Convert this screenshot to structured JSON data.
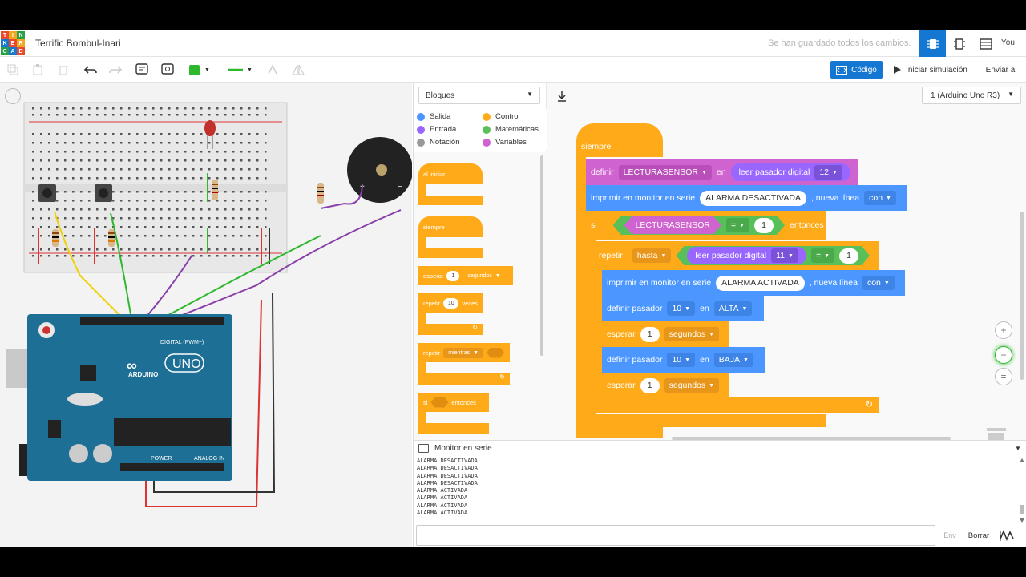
{
  "logo_letters": [
    "T",
    "I",
    "N",
    "K",
    "E",
    "R",
    "C",
    "A",
    "D"
  ],
  "logo_colors": [
    "#e84a2b",
    "#f0a820",
    "#2a9f4a",
    "#1477d1",
    "#e84a2b",
    "#f0a820",
    "#2a9f4a",
    "#1477d1",
    "#e84a2b"
  ],
  "header": {
    "title": "Terrific Bombul-Inari",
    "saved_status": "Se han guardado todos los cambios.",
    "user": "You"
  },
  "toolbar": {
    "code_label": "Código",
    "simulate_label": "Iniciar simulación",
    "send_label": "Enviar a",
    "fill_color": "#2eb82e"
  },
  "palette": {
    "selector": "Bloques",
    "categories": [
      {
        "label": "Salida",
        "color": "#4c97ff"
      },
      {
        "label": "Control",
        "color": "#ffab19"
      },
      {
        "label": "Entrada",
        "color": "#9966ff"
      },
      {
        "label": "Matemáticas",
        "color": "#59c059"
      },
      {
        "label": "Notación",
        "color": "#999999"
      },
      {
        "label": "Variables",
        "color": "#cf63cf"
      }
    ],
    "blocks": {
      "on_start": "al iniciar",
      "forever": "siempre",
      "wait": "esperar",
      "wait_value": "1",
      "wait_unit": "segundos",
      "repeat": "repetir",
      "repeat_value": "10",
      "repeat_unit": "veces",
      "repeat_while": "repetir",
      "while_opt": "mientras",
      "if": "si",
      "then": "entonces"
    }
  },
  "workspace": {
    "board": "1 (Arduino Uno R3)",
    "forever": "siempre",
    "set_label": "definir",
    "var_name": "LECTURASENSOR",
    "in_label": "en",
    "read_pin": "leer pasador digital",
    "pin_12": "12",
    "print_label": "imprimir en monitor en serie",
    "msg_off": "ALARMA DESACTIVADA",
    "newline": ", nueva línea",
    "with": "con",
    "if": "si",
    "eq": "=",
    "one": "1",
    "then": "entonces",
    "repeat": "repetir",
    "until": "hasta",
    "pin_11": "11",
    "msg_on": "ALARMA ACTIVADA",
    "set_pin": "definir pasador",
    "pin_10": "10",
    "high": "ALTA",
    "low": "BAJA",
    "wait": "esperar",
    "seconds": "segundos"
  },
  "serial": {
    "title": "Monitor en serie",
    "lines": [
      "ALARMA DESACTIVADA",
      "ALARMA DESACTIVADA",
      "ALARMA DESACTIVADA",
      "ALARMA DESACTIVADA",
      "ALARMA ACTIVADA",
      "ALARMA ACTIVADA",
      "ALARMA ACTIVADA",
      "ALARMA ACTIVADA"
    ],
    "send_label": "Env",
    "clear_label": "Borrar"
  },
  "arduino": {
    "brand": "ARDUINO",
    "model": "UNO",
    "digital": "DIGITAL (PWM~)",
    "power": "POWER",
    "analog": "ANALOG IN"
  }
}
